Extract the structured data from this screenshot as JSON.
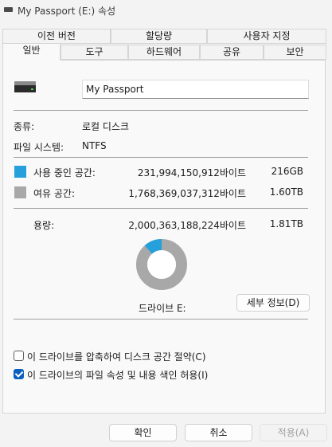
{
  "window": {
    "title": "My Passport (E:) 속성"
  },
  "tabs": {
    "row1": [
      "이전 버전",
      "할당량",
      "사용자 지정"
    ],
    "row2": [
      "일반",
      "도구",
      "하드웨어",
      "공유",
      "보안"
    ],
    "active": "일반"
  },
  "general": {
    "drive_name": "My Passport",
    "type_label": "종류:",
    "type_value": "로컬 디스크",
    "fs_label": "파일 시스템:",
    "fs_value": "NTFS",
    "used": {
      "label": "사용 중인 공간:",
      "bytes": "231,994,150,912바이트",
      "size": "216GB",
      "color": "#26a0da"
    },
    "free": {
      "label": "여유 공간:",
      "bytes": "1,768,369,037,312바이트",
      "size": "1.60TB",
      "color": "#a8a8a8"
    },
    "capacity": {
      "label": "용량:",
      "bytes": "2,000,363,188,224바이트",
      "size": "1.81TB"
    },
    "used_fraction": 0.116,
    "drive_label": "드라이브 E:",
    "details_button": "세부 정보(D)",
    "compress_checkbox": {
      "label": "이 드라이브를 압축하여 디스크 공간 절약(C)",
      "checked": false
    },
    "index_checkbox": {
      "label": "이 드라이브의 파일 속성 및 내용 색인 허용(I)",
      "checked": true
    }
  },
  "footer": {
    "ok": "확인",
    "cancel": "취소",
    "apply": "적용(A)"
  },
  "icons": [
    "drive-icon",
    "hard-drive-icon"
  ]
}
